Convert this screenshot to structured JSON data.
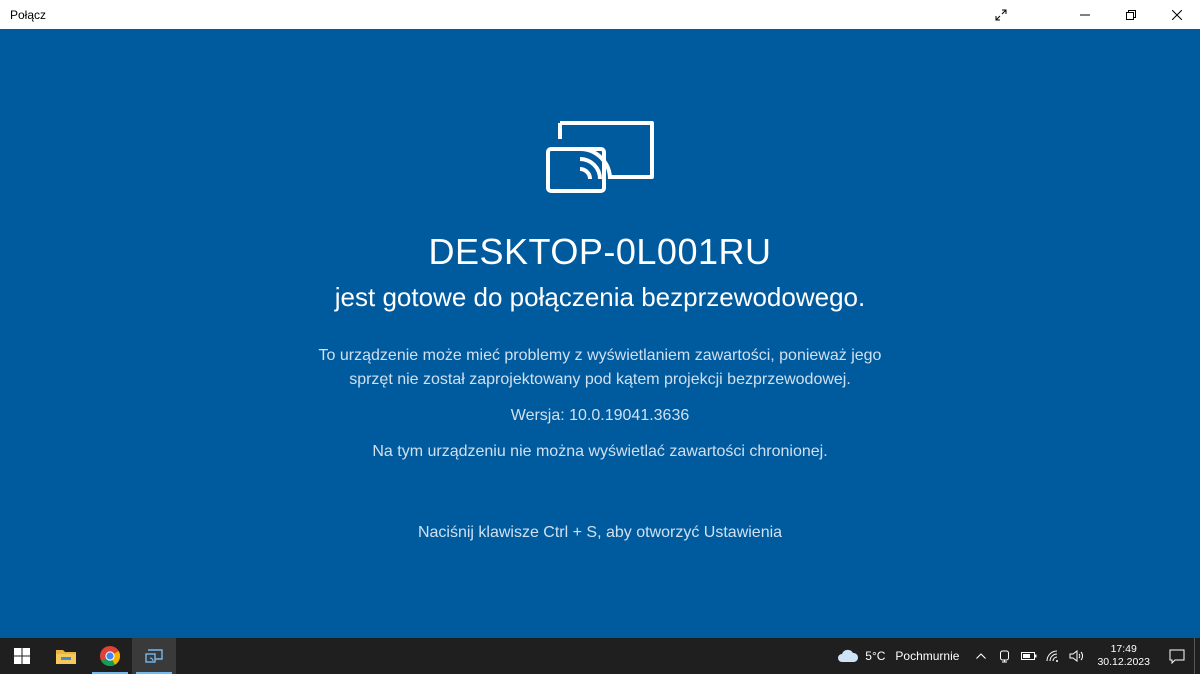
{
  "window": {
    "title": "Połącz"
  },
  "main": {
    "device_name": "DESKTOP-0L001RU",
    "ready_text": "jest gotowe do połączenia bezprzewodowego.",
    "warning_line1": "To urządzenie może mieć problemy z wyświetlaniem zawartości, ponieważ jego",
    "warning_line2": "sprzęt nie został zaprojektowany pod kątem projekcji bezprzewodowej.",
    "version": "Wersja: 10.0.19041.3636",
    "protected_content": "Na tym urządzeniu nie można wyświetlać zawartości chronionej.",
    "settings_hint": "Naciśnij klawisze Ctrl + S, aby otworzyć Ustawienia"
  },
  "taskbar": {
    "weather_temp": "5°C",
    "weather_desc": "Pochmurnie",
    "time": "17:49",
    "date": "30.12.2023"
  },
  "colors": {
    "background": "#005a9e",
    "taskbar": "#1f1f1f",
    "accent": "#76b9ed"
  },
  "icons": {
    "cast": "wireless-display-icon",
    "start": "windows-logo-icon",
    "explorer": "file-explorer-icon",
    "browser": "chrome-icon",
    "connect_app": "connect-app-icon"
  }
}
